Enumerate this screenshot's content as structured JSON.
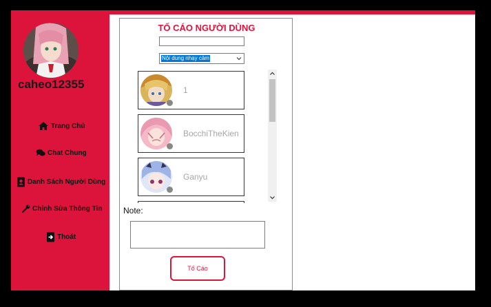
{
  "profile": {
    "username": "caheo12355"
  },
  "nav": [
    {
      "label": "Trang Chủ",
      "icon": "home-icon"
    },
    {
      "label": "Chat Chung",
      "icon": "chat-icon"
    },
    {
      "label": "Danh Sách Người Dùng",
      "icon": "contacts-icon"
    },
    {
      "label": "Chỉnh Sửa Thông Tin",
      "icon": "wrench-icon"
    },
    {
      "label": "Thoát",
      "icon": "logout-icon"
    }
  ],
  "report": {
    "title": "TỐ CÁO NGƯỜI DÙNG",
    "search_value": "",
    "reason_selected": "Nội dung nhạy cảm",
    "users": [
      {
        "name": "1"
      },
      {
        "name": "BocchiTheKien"
      },
      {
        "name": "Ganyu"
      }
    ],
    "note_label": "Note:",
    "note_value": "",
    "submit_label": "Tố Cáo"
  },
  "colors": {
    "accent": "#dc143c",
    "status_offline": "#888888"
  }
}
